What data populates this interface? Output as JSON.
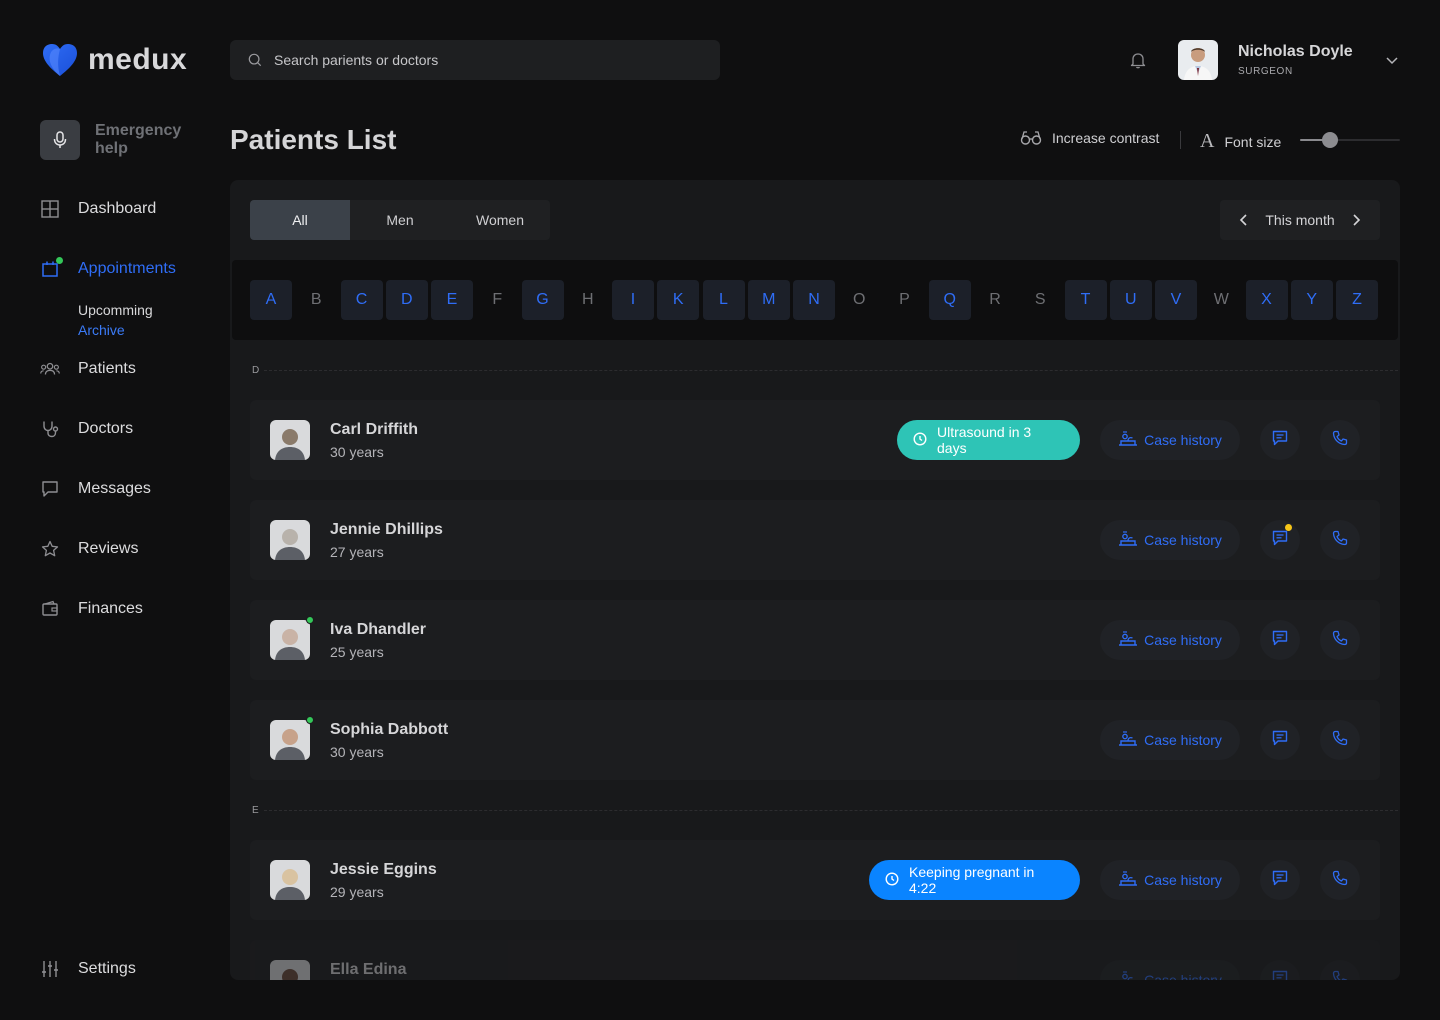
{
  "app": {
    "name": "medux"
  },
  "search": {
    "placeholder": "Search parients or doctors"
  },
  "user": {
    "name": "Nicholas Doyle",
    "role": "SURGEON"
  },
  "sidebar": {
    "emergency_label": "Emergency help",
    "items": [
      {
        "label": "Dashboard",
        "icon": "grid-icon"
      },
      {
        "label": "Appointments",
        "icon": "calendar-icon",
        "active": true
      },
      {
        "label": "Patients",
        "icon": "users-icon"
      },
      {
        "label": "Doctors",
        "icon": "stethoscope-icon"
      },
      {
        "label": "Messages",
        "icon": "message-icon"
      },
      {
        "label": "Reviews",
        "icon": "star-icon"
      },
      {
        "label": "Finances",
        "icon": "wallet-icon"
      }
    ],
    "sub_items": [
      {
        "label": "Upcomming"
      },
      {
        "label": "Archive",
        "active": true
      }
    ],
    "settings_label": "Settings"
  },
  "page": {
    "title": "Patients List"
  },
  "accessibility": {
    "contrast_label": "Increase contrast",
    "font_size_label": "Font size",
    "font_size_level": 0.3
  },
  "filters": {
    "gender_tabs": [
      {
        "label": "All",
        "active": true
      },
      {
        "label": "Men"
      },
      {
        "label": "Women"
      }
    ],
    "period_label": "This month"
  },
  "alphabet": [
    {
      "letter": "A",
      "on": true
    },
    {
      "letter": "B",
      "on": false
    },
    {
      "letter": "C",
      "on": true
    },
    {
      "letter": "D",
      "on": true
    },
    {
      "letter": "E",
      "on": true
    },
    {
      "letter": "F",
      "on": false
    },
    {
      "letter": "G",
      "on": true
    },
    {
      "letter": "H",
      "on": false
    },
    {
      "letter": "I",
      "on": true
    },
    {
      "letter": "K",
      "on": true
    },
    {
      "letter": "L",
      "on": true
    },
    {
      "letter": "M",
      "on": true
    },
    {
      "letter": "N",
      "on": true
    },
    {
      "letter": "O",
      "on": false
    },
    {
      "letter": "P",
      "on": false
    },
    {
      "letter": "Q",
      "on": true
    },
    {
      "letter": "R",
      "on": false
    },
    {
      "letter": "S",
      "on": false
    },
    {
      "letter": "T",
      "on": true
    },
    {
      "letter": "U",
      "on": true
    },
    {
      "letter": "V",
      "on": true
    },
    {
      "letter": "W",
      "on": false
    },
    {
      "letter": "X",
      "on": true
    },
    {
      "letter": "Y",
      "on": true
    },
    {
      "letter": "Z",
      "on": true
    }
  ],
  "sections": [
    {
      "letter": "D",
      "patients": [
        {
          "name": "Carl Driffith",
          "age": "30 years",
          "online": false,
          "badge": {
            "text": "Ultrasound in 3 days",
            "color": "#2ec4b6"
          },
          "unread": false,
          "avatar_tone": "#8a7a6a"
        },
        {
          "name": "Jennie Dhillips",
          "age": "27 years",
          "online": false,
          "badge": null,
          "unread": true,
          "avatar_tone": "#b8b2ab"
        },
        {
          "name": "Iva Dhandler",
          "age": "25 years",
          "online": true,
          "badge": null,
          "unread": false,
          "avatar_tone": "#c9b3a6"
        },
        {
          "name": "Sophia Dabbott",
          "age": "30 years",
          "online": true,
          "badge": null,
          "unread": false,
          "avatar_tone": "#c7a28a"
        }
      ]
    },
    {
      "letter": "E",
      "patients": [
        {
          "name": "Jessie Eggins",
          "age": "29 years",
          "online": false,
          "badge": {
            "text": "Keeping pregnant in 4:22",
            "color": "#0a84ff"
          },
          "unread": false,
          "avatar_tone": "#d9c3a1"
        },
        {
          "name": "Ella Edina",
          "age": "",
          "online": false,
          "badge": null,
          "unread": false,
          "avatar_tone": "#6b4a3a"
        }
      ]
    }
  ],
  "row_actions": {
    "case_history_label": "Case history"
  },
  "colors": {
    "accent": "#2f6df6",
    "online": "#34c759",
    "unread": "#f5c518"
  }
}
